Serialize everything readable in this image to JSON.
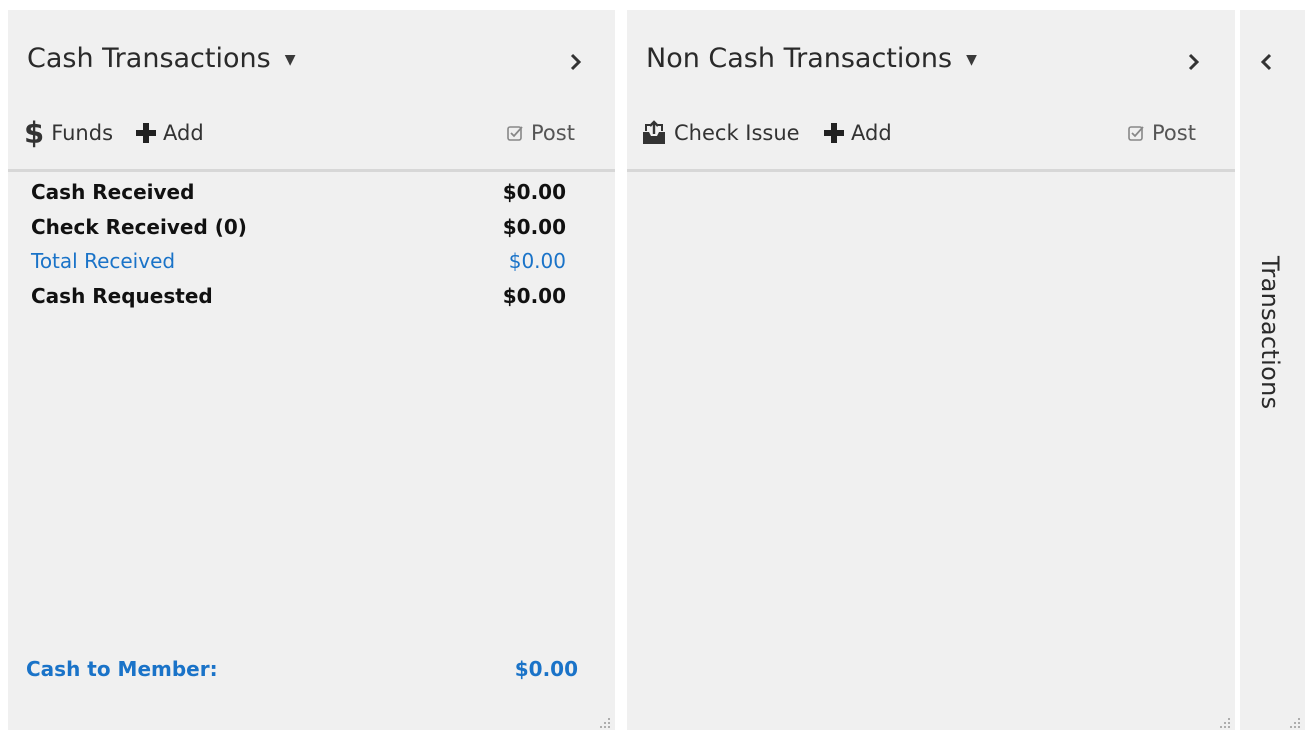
{
  "cash_panel": {
    "title": "Cash Transactions",
    "toolbar": {
      "funds_label": "Funds",
      "add_label": "Add",
      "post_label": "Post"
    },
    "rows": [
      {
        "label": "Cash Received",
        "value": "$0.00",
        "highlight": false
      },
      {
        "label": "Check Received (0)",
        "value": "$0.00",
        "highlight": false
      },
      {
        "label": "Total Received",
        "value": "$0.00",
        "highlight": true
      },
      {
        "label": "Cash Requested",
        "value": "$0.00",
        "highlight": false
      }
    ],
    "footer": {
      "label": "Cash to Member:",
      "value": "$0.00"
    }
  },
  "noncash_panel": {
    "title": "Non Cash Transactions",
    "toolbar": {
      "check_issue_label": "Check Issue",
      "add_label": "Add",
      "post_label": "Post"
    }
  },
  "side_panel": {
    "label": "Transactions"
  },
  "icons": {
    "dropdown": "caret-down-icon",
    "expand": "chevron-right-icon",
    "collapse": "chevron-left-icon",
    "funds": "dollar-icon",
    "add": "plus-icon",
    "post": "checkbox-icon",
    "check_issue": "outbox-upload-icon",
    "resize": "resize-grip-icon"
  },
  "colors": {
    "panel_bg": "#f0f0f0",
    "accent_blue": "#1a73c8",
    "separator": "#d7d7d7"
  }
}
